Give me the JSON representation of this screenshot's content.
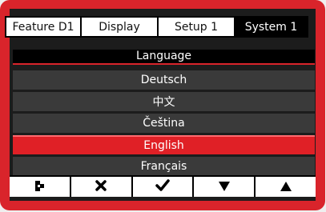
{
  "tabs": [
    {
      "label": "Feature D1"
    },
    {
      "label": "Display"
    },
    {
      "label": "Setup 1"
    },
    {
      "label": "System 1"
    }
  ],
  "active_tab": "System 1",
  "menu": {
    "title": "Language",
    "items": [
      {
        "label": "Deutsch"
      },
      {
        "label": "中文"
      },
      {
        "label": "Čeština"
      },
      {
        "label": "English"
      },
      {
        "label": "Français"
      }
    ],
    "selected": "English"
  },
  "toolbar": {
    "buttons": [
      {
        "icon": "exit-icon"
      },
      {
        "icon": "cancel-icon"
      },
      {
        "icon": "confirm-icon"
      },
      {
        "icon": "down-arrow-icon"
      },
      {
        "icon": "up-arrow-icon"
      }
    ]
  },
  "colors": {
    "frame": "#d9242b",
    "selected": "#e02026",
    "item_bg": "#3a3a3a"
  }
}
